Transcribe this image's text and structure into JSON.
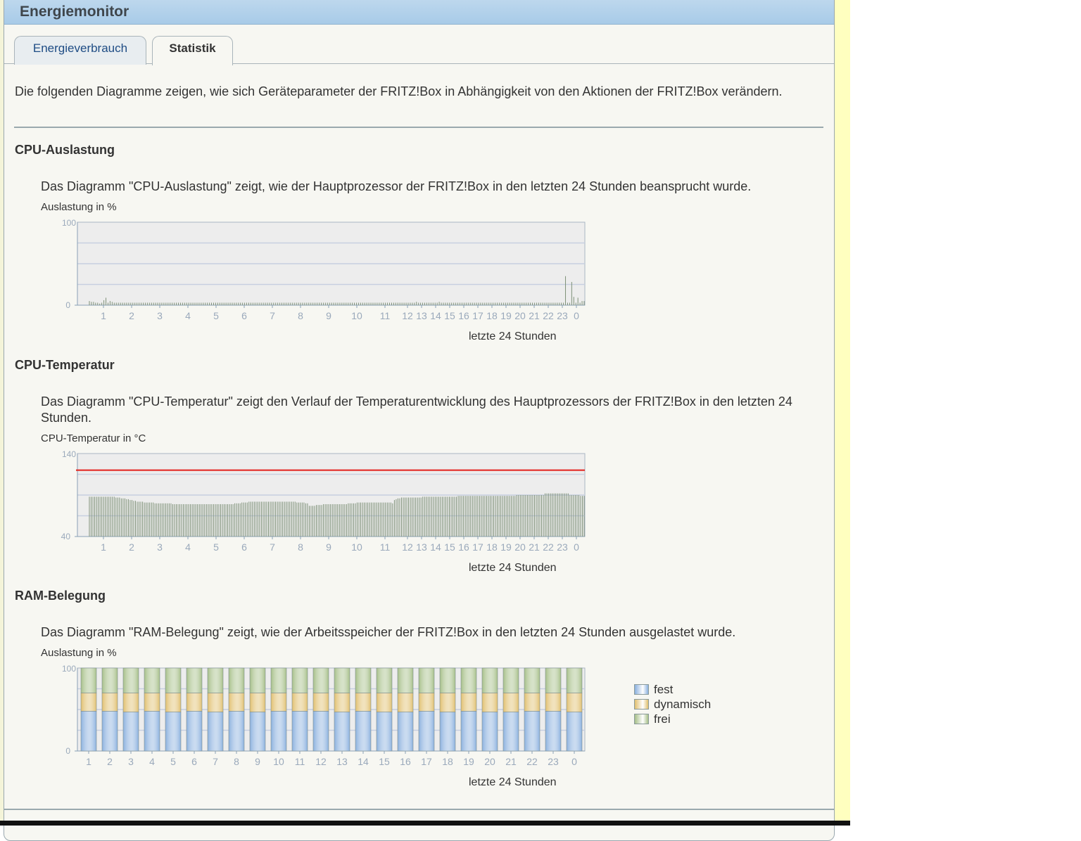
{
  "window": {
    "title": "Energiemonitor"
  },
  "tabs": [
    {
      "label": "Energieverbrauch",
      "active": false
    },
    {
      "label": "Statistik",
      "active": true
    }
  ],
  "intro": "Die folgenden Diagramme zeigen, wie sich Geräteparameter der FRITZ!Box in Abhängigkeit von den Aktionen der FRITZ!Box verändern.",
  "colors": {
    "bar_green": "#7e9178",
    "grid_bg": "#ededed",
    "limit_line": "#e3201b",
    "fest": "#8ab0de",
    "dynamisch": "#e0bf6e",
    "frei": "#a6bf88",
    "tick_text": "#9aa9bb"
  },
  "sections": {
    "cpu_load": {
      "title": "CPU-Auslastung",
      "description": "Das Diagramm \"CPU-Auslastung\" zeigt, wie der Hauptprozessor der FRITZ!Box in den letzten 24 Stunden beansprucht wurde.",
      "unit_label": "Auslastung in %",
      "x_caption": "letzte 24 Stunden"
    },
    "cpu_temp": {
      "title": "CPU-Temperatur",
      "description": "Das Diagramm \"CPU-Temperatur\" zeigt den Verlauf der Temperaturentwicklung des Hauptprozessors der FRITZ!Box in den letzten 24 Stunden.",
      "unit_label": "CPU-Temperatur in °C",
      "x_caption": "letzte 24 Stunden"
    },
    "ram": {
      "title": "RAM-Belegung",
      "description": "Das Diagramm \"RAM-Belegung\" zeigt, wie der Arbeitsspeicher der FRITZ!Box in den letzten 24 Stunden ausgelastet wurde.",
      "unit_label": "Auslastung in %",
      "x_caption": "letzte 24 Stunden",
      "legend": [
        "fest",
        "dynamisch",
        "frei"
      ]
    }
  },
  "chart_data": [
    {
      "type": "bar",
      "ylim": [
        0,
        100
      ],
      "yticks": [
        "100",
        "0"
      ],
      "xticks": [
        "1",
        "2",
        "3",
        "4",
        "5",
        "6",
        "7",
        "8",
        "9",
        "10",
        "11",
        "12",
        "13",
        "14",
        "15",
        "16",
        "17",
        "18",
        "19",
        "20",
        "21",
        "22",
        "23",
        "0"
      ],
      "xlabel": "letzte 24 Stunden",
      "ylabel": "Auslastung in %",
      "values": [
        5,
        4,
        4,
        3,
        3,
        2,
        3,
        6,
        9,
        3,
        5,
        4,
        3,
        3,
        3,
        3,
        3,
        3,
        3,
        3,
        3,
        3,
        3,
        3,
        3,
        3,
        3,
        3,
        3,
        3,
        3,
        3,
        3,
        3,
        3,
        3,
        3,
        3,
        3,
        3,
        3,
        3,
        3,
        3,
        3,
        3,
        3,
        3,
        3,
        3,
        3,
        3,
        3,
        3,
        3,
        3,
        3,
        3,
        3,
        3,
        3,
        3,
        3,
        3,
        3,
        3,
        3,
        3,
        3,
        3,
        3,
        3,
        3,
        3,
        3,
        3,
        3,
        3,
        3,
        3,
        3,
        3,
        3,
        3,
        3,
        3,
        3,
        3,
        3,
        3,
        3,
        3,
        3,
        3,
        3,
        3,
        3,
        3,
        3,
        3,
        3,
        3,
        3,
        3,
        3,
        3,
        3,
        3,
        3,
        3,
        3,
        3,
        3,
        3,
        3,
        3,
        3,
        3,
        3,
        3,
        3,
        3,
        3,
        3,
        3,
        3,
        3,
        3,
        3,
        3,
        3,
        3,
        3,
        3,
        3,
        3,
        3,
        3,
        3,
        3,
        3,
        3,
        3,
        3,
        3,
        3,
        3,
        3,
        3,
        3,
        3,
        3,
        3,
        3,
        3,
        3,
        3,
        3,
        4,
        3,
        3,
        3,
        3,
        3,
        3,
        3,
        3,
        3,
        3,
        4,
        3,
        3,
        3,
        3,
        3,
        3,
        3,
        3,
        3,
        3,
        3,
        3,
        3,
        3,
        3,
        3,
        3,
        3,
        3,
        3,
        3,
        3,
        3,
        3,
        3,
        3,
        3,
        3,
        3,
        3,
        3,
        3,
        3,
        3,
        3,
        3,
        3,
        3,
        3,
        3,
        3,
        3,
        3,
        3,
        3,
        3,
        3,
        3,
        3,
        3,
        3,
        3,
        3,
        3,
        3,
        3,
        3,
        3,
        3,
        3,
        35,
        3,
        3,
        28,
        10,
        3,
        9,
        3,
        5,
        5
      ]
    },
    {
      "type": "bar",
      "ylim": [
        40,
        140
      ],
      "yticks": [
        "140",
        "40"
      ],
      "xticks": [
        "1",
        "2",
        "3",
        "4",
        "5",
        "6",
        "7",
        "8",
        "9",
        "10",
        "11",
        "12",
        "13",
        "14",
        "15",
        "16",
        "17",
        "18",
        "19",
        "20",
        "21",
        "22",
        "23",
        "0"
      ],
      "xlabel": "letzte 24 Stunden",
      "ylabel": "CPU-Temperatur in °C",
      "limit": 120,
      "values": [
        88,
        88,
        88,
        88,
        88,
        88,
        88,
        88,
        88,
        88,
        88,
        88,
        88,
        88,
        88,
        87,
        87,
        87,
        86,
        86,
        86,
        85,
        85,
        84,
        84,
        83,
        83,
        82,
        82,
        82,
        82,
        81,
        81,
        81,
        81,
        81,
        81,
        80,
        80,
        80,
        80,
        80,
        80,
        80,
        80,
        80,
        80,
        79,
        79,
        79,
        79,
        79,
        79,
        79,
        79,
        79,
        79,
        79,
        79,
        79,
        79,
        79,
        79,
        79,
        79,
        79,
        79,
        79,
        79,
        79,
        79,
        79,
        79,
        79,
        79,
        79,
        79,
        79,
        79,
        79,
        79,
        79,
        80,
        80,
        80,
        80,
        81,
        81,
        81,
        81,
        82,
        82,
        82,
        82,
        82,
        82,
        82,
        82,
        82,
        82,
        82,
        82,
        82,
        82,
        82,
        82,
        82,
        82,
        82,
        82,
        82,
        82,
        82,
        82,
        82,
        82,
        82,
        81,
        81,
        81,
        81,
        81,
        80,
        80,
        77,
        77,
        77,
        77,
        78,
        78,
        78,
        78,
        79,
        79,
        79,
        79,
        79,
        79,
        79,
        79,
        79,
        79,
        79,
        79,
        79,
        79,
        80,
        80,
        80,
        80,
        80,
        81,
        81,
        81,
        81,
        81,
        81,
        81,
        81,
        81,
        81,
        81,
        81,
        81,
        81,
        81,
        81,
        81,
        81,
        81,
        81,
        80,
        84,
        85,
        86,
        86,
        87,
        87,
        87,
        87,
        87,
        87,
        87,
        87,
        87,
        87,
        87,
        87,
        88,
        88,
        88,
        88,
        88,
        88,
        88,
        88,
        88,
        88,
        88,
        88,
        88,
        88,
        88,
        88,
        88,
        88,
        88,
        88,
        89,
        89,
        89,
        89,
        89,
        89,
        89,
        89,
        89,
        89,
        89,
        89,
        89,
        89,
        89,
        89,
        89,
        89,
        89,
        89,
        89,
        89,
        89,
        89,
        89,
        89,
        89,
        89,
        89,
        89,
        89,
        89,
        89,
        90,
        90,
        90,
        90,
        90,
        90,
        90,
        90,
        90,
        90,
        90,
        90,
        90,
        90,
        90,
        90,
        92,
        92,
        92,
        92,
        92,
        92,
        92,
        92,
        92,
        92,
        92,
        92,
        92,
        92,
        90,
        90,
        90,
        90,
        90,
        90,
        89,
        89,
        89
      ]
    },
    {
      "type": "bar",
      "stacked": true,
      "ylim": [
        0,
        100
      ],
      "yticks": [
        "100",
        "0"
      ],
      "categories": [
        "1",
        "2",
        "3",
        "4",
        "5",
        "6",
        "7",
        "8",
        "9",
        "10",
        "11",
        "12",
        "13",
        "14",
        "15",
        "16",
        "17",
        "18",
        "19",
        "20",
        "21",
        "22",
        "23",
        "0"
      ],
      "xlabel": "letzte 24 Stunden",
      "ylabel": "Auslastung in %",
      "series": [
        {
          "name": "fest",
          "values": [
            48,
            48,
            47,
            48,
            47,
            48,
            47,
            48,
            47,
            48,
            48,
            48,
            47,
            48,
            47,
            47,
            48,
            47,
            48,
            47,
            47,
            48,
            48,
            47
          ]
        },
        {
          "name": "dynamisch",
          "values": [
            22,
            22,
            23,
            22,
            23,
            22,
            23,
            22,
            23,
            22,
            22,
            22,
            23,
            22,
            23,
            23,
            22,
            23,
            22,
            23,
            23,
            22,
            22,
            23
          ]
        },
        {
          "name": "frei",
          "values": [
            30,
            30,
            30,
            30,
            30,
            30,
            30,
            30,
            30,
            30,
            30,
            30,
            30,
            30,
            30,
            30,
            30,
            30,
            30,
            30,
            30,
            30,
            30,
            30
          ]
        }
      ]
    }
  ]
}
